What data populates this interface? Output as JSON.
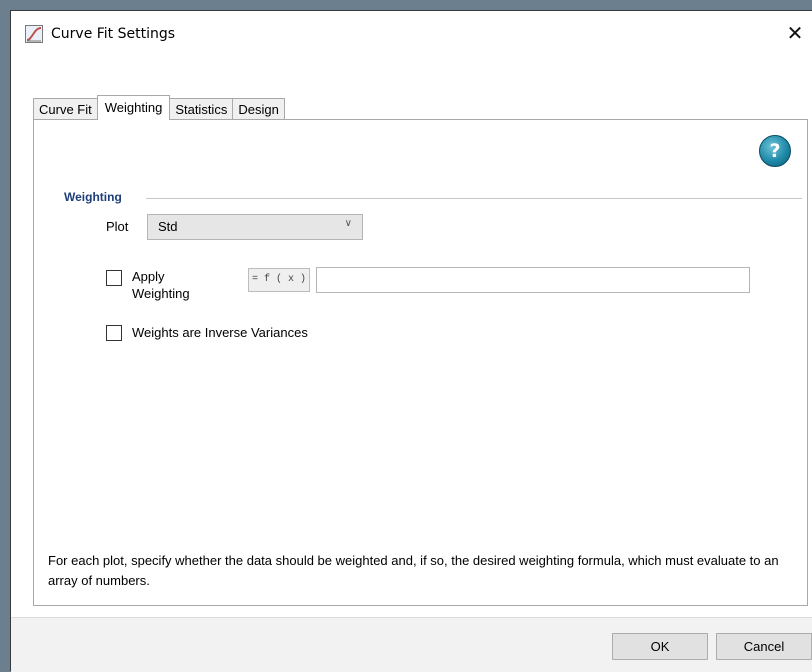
{
  "window": {
    "title": "Curve Fit Settings",
    "close_glyph": "✕"
  },
  "tabs": [
    {
      "label": "Curve Fit",
      "active": false
    },
    {
      "label": "Weighting",
      "active": true
    },
    {
      "label": "Statistics",
      "active": false
    },
    {
      "label": "Design",
      "active": false
    }
  ],
  "help": {
    "glyph": "?",
    "icon": "help-icon"
  },
  "weighting": {
    "section_label": "Weighting",
    "plot_label": "Plot",
    "plot_value": "Std",
    "apply_label_line1": "Apply",
    "apply_label_line2": "Weighting",
    "apply_checked": false,
    "fx_label": "= f ( x )",
    "formula_value": "",
    "inverse_label": "Weights are Inverse Variances",
    "inverse_checked": false
  },
  "footer": {
    "text": "For each plot, specify whether the data should be weighted and, if so, the desired weighting formula, which must evaluate to an array of numbers."
  },
  "buttons": {
    "ok": "OK",
    "cancel": "Cancel"
  },
  "colors": {
    "section_label": "#1f3f7a",
    "help_icon": "#1f8aa8"
  }
}
